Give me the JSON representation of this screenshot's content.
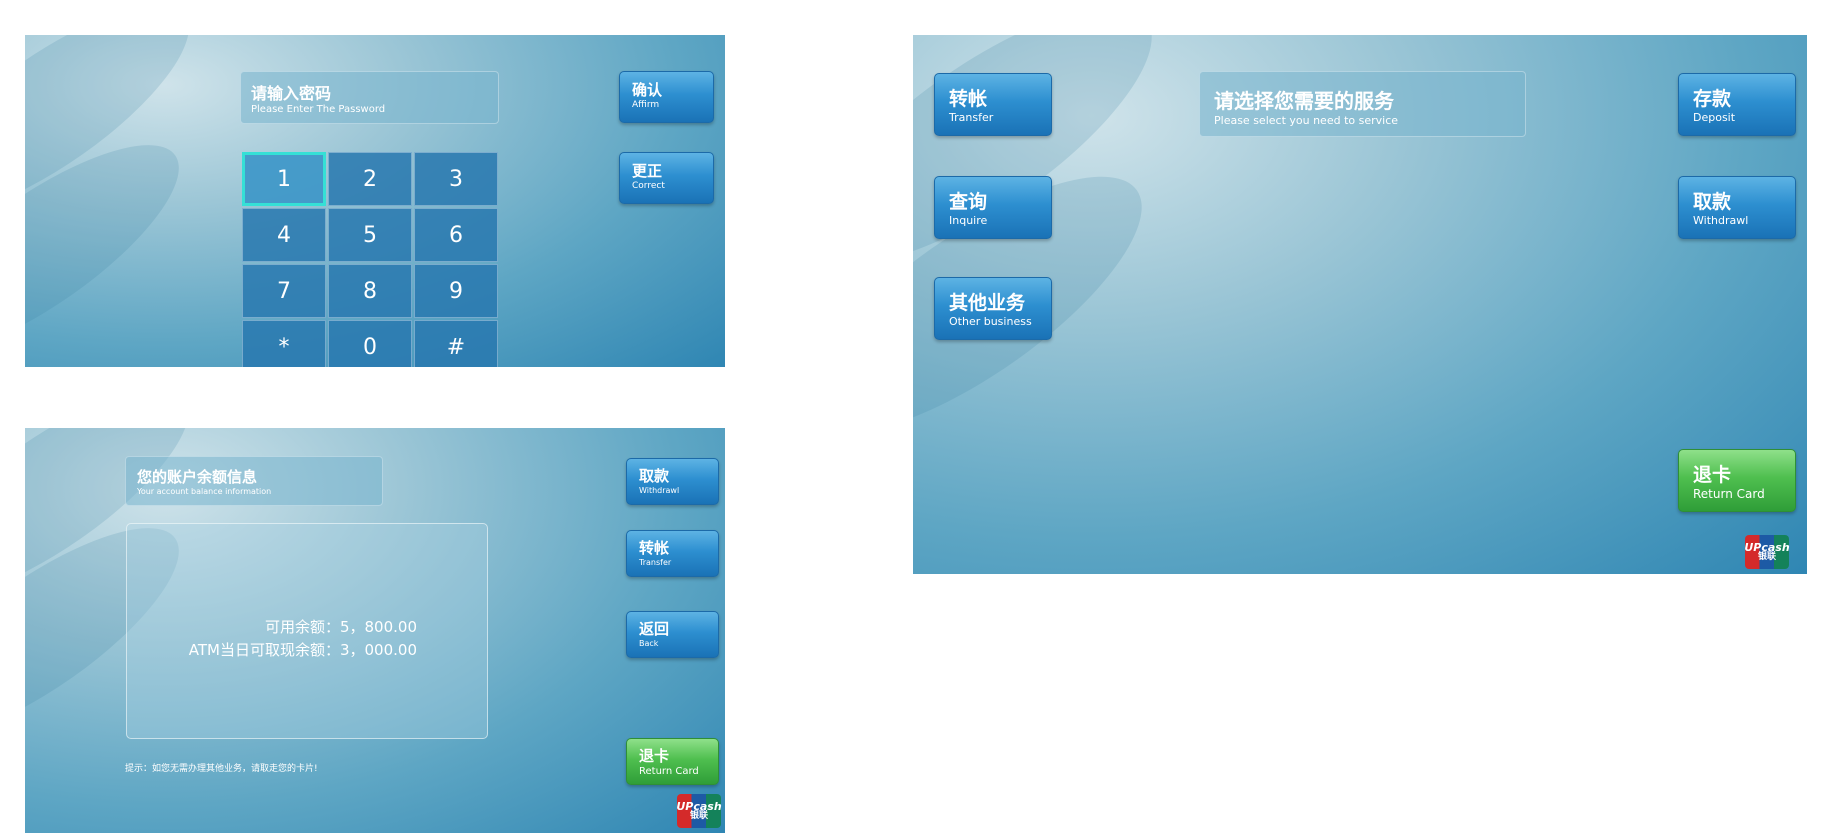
{
  "password_screen": {
    "title_cn": "请输入密码",
    "title_en": "Please Enter The Password",
    "keys": [
      "1",
      "2",
      "3",
      "4",
      "5",
      "6",
      "7",
      "8",
      "9",
      "*",
      "0",
      "#"
    ],
    "affirm": {
      "cn": "确认",
      "en": "Affirm"
    },
    "correct": {
      "cn": "更正",
      "en": "Correct"
    }
  },
  "balance_screen": {
    "title_cn": "您的账户余额信息",
    "title_en": "Your account balance information",
    "available_label": "可用余额：",
    "available_value": "5，800.00",
    "atm_label": "ATM当日可取现余额：",
    "atm_value": "3，000.00",
    "hint": "提示：如您无需办理其他业务，请取走您的卡片!",
    "withdraw": {
      "cn": "取款",
      "en": "Withdrawl"
    },
    "transfer": {
      "cn": "转帐",
      "en": "Transfer"
    },
    "back": {
      "cn": "返回",
      "en": "Back"
    },
    "return_card": {
      "cn": "退卡",
      "en": "Return Card"
    },
    "logo_text": "UPcash",
    "logo_sub": "银联"
  },
  "menu_screen": {
    "title_cn": "请选择您需要的服务",
    "title_en": "Please select you need to service",
    "transfer": {
      "cn": "转帐",
      "en": "Transfer"
    },
    "inquire": {
      "cn": "查询",
      "en": "Inquire"
    },
    "other": {
      "cn": "其他业务",
      "en": "Other business"
    },
    "deposit": {
      "cn": "存款",
      "en": "Deposit"
    },
    "withdraw": {
      "cn": "取款",
      "en": "Withdrawl"
    },
    "return_card": {
      "cn": "退卡",
      "en": "Return Card"
    },
    "logo_text": "UPcash",
    "logo_sub": "银联"
  },
  "colors": {
    "button_blue": "#2d8fd0",
    "button_green": "#4fbf4f",
    "key_highlight": "#35e0d6",
    "background": "#5ea6c4"
  }
}
